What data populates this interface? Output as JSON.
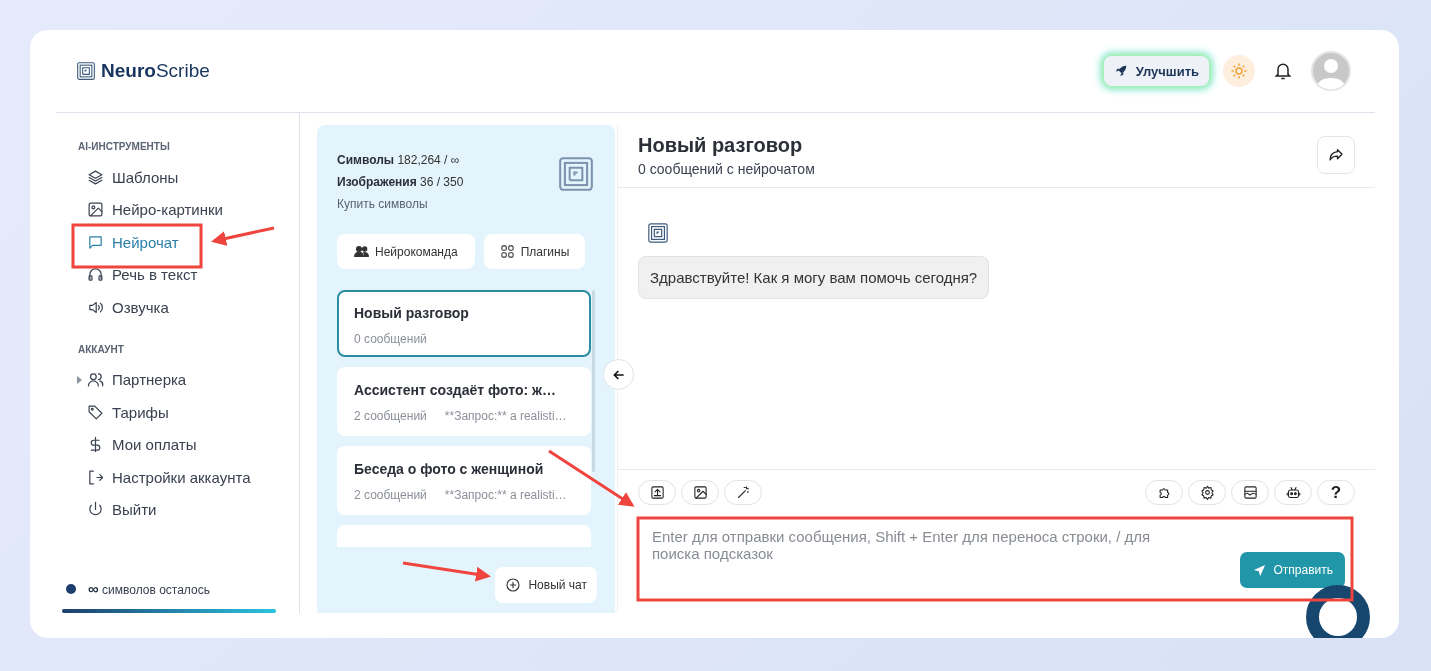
{
  "header": {
    "logo": {
      "bold": "Neuro",
      "light": "Scribe"
    },
    "upgrade_button": "Улучшить"
  },
  "sidebar": {
    "sections": [
      {
        "title": "AI-ИНСТРУМЕНТЫ",
        "items": [
          {
            "label": "Шаблоны",
            "selected": false
          },
          {
            "label": "Нейро-картинки",
            "selected": false
          },
          {
            "label": "Нейрочат",
            "selected": true
          },
          {
            "label": "Речь в текст",
            "selected": false
          },
          {
            "label": "Озвучка",
            "selected": false
          }
        ]
      },
      {
        "title": "АККАУНТ",
        "items": [
          {
            "label": "Партнерка",
            "selected": false,
            "expanded": false
          },
          {
            "label": "Тарифы",
            "selected": false
          },
          {
            "label": "Мои оплаты",
            "selected": false
          },
          {
            "label": "Настройки аккаунта",
            "selected": false
          },
          {
            "label": "Выйти",
            "selected": false
          }
        ]
      }
    ],
    "balance": {
      "symbol": "∞",
      "text": "символов осталось",
      "level": 1
    }
  },
  "chats_panel": {
    "stats": [
      {
        "label": "Символы",
        "value": "182,264 / ∞"
      },
      {
        "label": "Изображения",
        "value": "36 / 350"
      }
    ],
    "buy_link": "Купить символы",
    "buttons": [
      "Нейрокоманда",
      "Плагины"
    ],
    "chats": [
      {
        "title": "Новый разговор",
        "count": "0 сообщений",
        "selected": true
      },
      {
        "title": "Ассистент создаёт фото: ж…",
        "count": "2 сообщений",
        "preview": "**Запрос:** a realisti…",
        "selected": false
      },
      {
        "title": "Беседа о фото с женщиной",
        "count": "2 сообщений",
        "preview": "**Запрос:** a realisti…",
        "selected": false
      }
    ],
    "new_chat": "Новый чат"
  },
  "chat": {
    "title": "Новый разговор",
    "subtitle": "0 сообщений с нейрочатом",
    "messages": [
      "Здравствуйте! Как я могу вам помочь сегодня?"
    ],
    "help_button": "?",
    "input": {
      "placeholder": "Enter для отправки сообщения, Shift + Enter для переноса строки, / для поиска подсказок"
    },
    "send_button": "Отправить"
  }
}
